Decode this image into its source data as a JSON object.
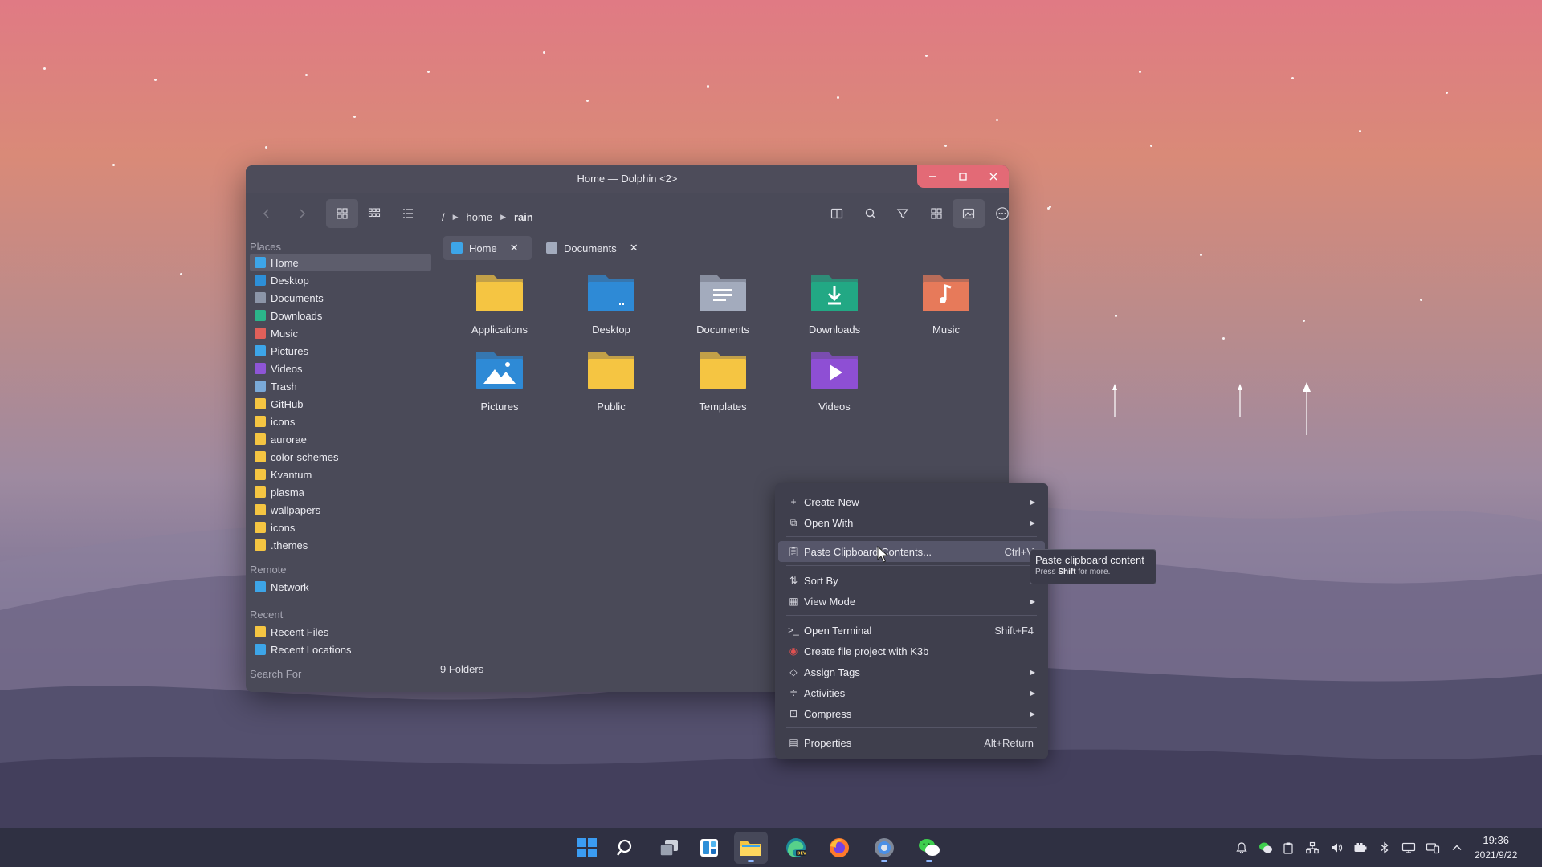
{
  "window": {
    "title": "Home — Dolphin <2>",
    "controls": {
      "minimize": "–",
      "maximize": "☐",
      "close": "✕"
    }
  },
  "breadcrumb": {
    "root": "/",
    "parts": [
      "home",
      "rain"
    ]
  },
  "sidebar": {
    "places_label": "Places",
    "places": [
      {
        "label": "Home",
        "icon": "home-folder-icon",
        "color": "#3da5e8"
      },
      {
        "label": "Desktop",
        "icon": "desktop-folder-icon",
        "color": "#2d8fd8"
      },
      {
        "label": "Documents",
        "icon": "documents-icon",
        "color": "#8c95a8"
      },
      {
        "label": "Downloads",
        "icon": "download-icon",
        "color": "#2bb58a"
      },
      {
        "label": "Music",
        "icon": "music-icon",
        "color": "#e0605a"
      },
      {
        "label": "Pictures",
        "icon": "pictures-icon",
        "color": "#3da5e8"
      },
      {
        "label": "Videos",
        "icon": "videos-icon",
        "color": "#8e55d6"
      },
      {
        "label": "Trash",
        "icon": "trash-icon",
        "color": "#7aa9d8"
      },
      {
        "label": "GitHub",
        "icon": "folder-icon",
        "color": "#f5c542"
      },
      {
        "label": "icons",
        "icon": "folder-icon",
        "color": "#f5c542"
      },
      {
        "label": "aurorae",
        "icon": "folder-icon",
        "color": "#f5c542"
      },
      {
        "label": "color-schemes",
        "icon": "folder-icon",
        "color": "#f5c542"
      },
      {
        "label": "Kvantum",
        "icon": "folder-icon",
        "color": "#f5c542"
      },
      {
        "label": "plasma",
        "icon": "folder-icon",
        "color": "#f5c542"
      },
      {
        "label": "wallpapers",
        "icon": "folder-icon",
        "color": "#f5c542"
      },
      {
        "label": "icons",
        "icon": "folder-icon",
        "color": "#f5c542"
      },
      {
        "label": ".themes",
        "icon": "folder-icon",
        "color": "#f5c542"
      }
    ],
    "remote_label": "Remote",
    "remote": [
      {
        "label": "Network",
        "icon": "network-icon",
        "color": "#3da5e8"
      }
    ],
    "recent_label": "Recent",
    "recent": [
      {
        "label": "Recent Files",
        "icon": "recent-files-icon",
        "color": "#f5c542"
      },
      {
        "label": "Recent Locations",
        "icon": "recent-locations-icon",
        "color": "#3da5e8"
      }
    ],
    "search_label": "Search For"
  },
  "tabs": [
    {
      "label": "Home",
      "icon": "home-folder-icon"
    },
    {
      "label": "Documents",
      "icon": "documents-icon"
    }
  ],
  "folders": [
    {
      "label": "Applications",
      "icon": "folder-icon",
      "color": "#f5c542"
    },
    {
      "label": "Desktop",
      "icon": "desktop-folder-icon",
      "color": "#2e8ad6"
    },
    {
      "label": "Documents",
      "icon": "documents-folder-icon",
      "color": "#a3abbd"
    },
    {
      "label": "Downloads",
      "icon": "downloads-folder-icon",
      "color": "#22a884"
    },
    {
      "label": "Music",
      "icon": "music-folder-icon",
      "color": "#e77a5a"
    },
    {
      "label": "Pictures",
      "icon": "pictures-folder-icon",
      "color": "#2e8ad6"
    },
    {
      "label": "Public",
      "icon": "folder-icon",
      "color": "#f5c542"
    },
    {
      "label": "Templates",
      "icon": "folder-icon",
      "color": "#f5c542"
    },
    {
      "label": "Videos",
      "icon": "videos-folder-icon",
      "color": "#8e4fd4"
    }
  ],
  "status": "9 Folders",
  "context_menu": {
    "items": [
      {
        "label": "Create New",
        "icon": "plus-icon",
        "submenu": true
      },
      {
        "label": "Open With",
        "icon": "open-with-icon",
        "submenu": true
      },
      {
        "label": "Paste Clipboard Contents...",
        "icon": "clipboard-icon",
        "shortcut": "Ctrl+V"
      },
      {
        "label": "Sort By",
        "icon": "sort-icon",
        "submenu": true
      },
      {
        "label": "View Mode",
        "icon": "view-mode-icon",
        "submenu": true
      },
      {
        "label": "Open Terminal",
        "icon": "terminal-icon",
        "shortcut": "Shift+F4"
      },
      {
        "label": "Create file project with K3b",
        "icon": "k3b-icon"
      },
      {
        "label": "Assign Tags",
        "icon": "tag-icon",
        "submenu": true
      },
      {
        "label": "Activities",
        "icon": "activities-icon",
        "submenu": true
      },
      {
        "label": "Compress",
        "icon": "compress-icon",
        "submenu": true
      },
      {
        "label": "Properties",
        "icon": "properties-icon",
        "shortcut": "Alt+Return"
      }
    ]
  },
  "tooltip": {
    "title": "Paste clipboard content",
    "press": "Press",
    "key": "Shift",
    "rest": "for more."
  },
  "taskbar": {
    "apps": [
      "start-icon",
      "search-icon",
      "task-view-icon",
      "widgets-icon",
      "file-manager-icon",
      "edge-dev-icon",
      "firefox-icon",
      "settings-icon",
      "wechat-icon"
    ],
    "clock_time": "19:36",
    "clock_date": "2021/9/22"
  },
  "colors": {
    "accent": "#e36a76",
    "window_bg": "#4a4a58",
    "menu_bg": "#3f3f4d"
  }
}
